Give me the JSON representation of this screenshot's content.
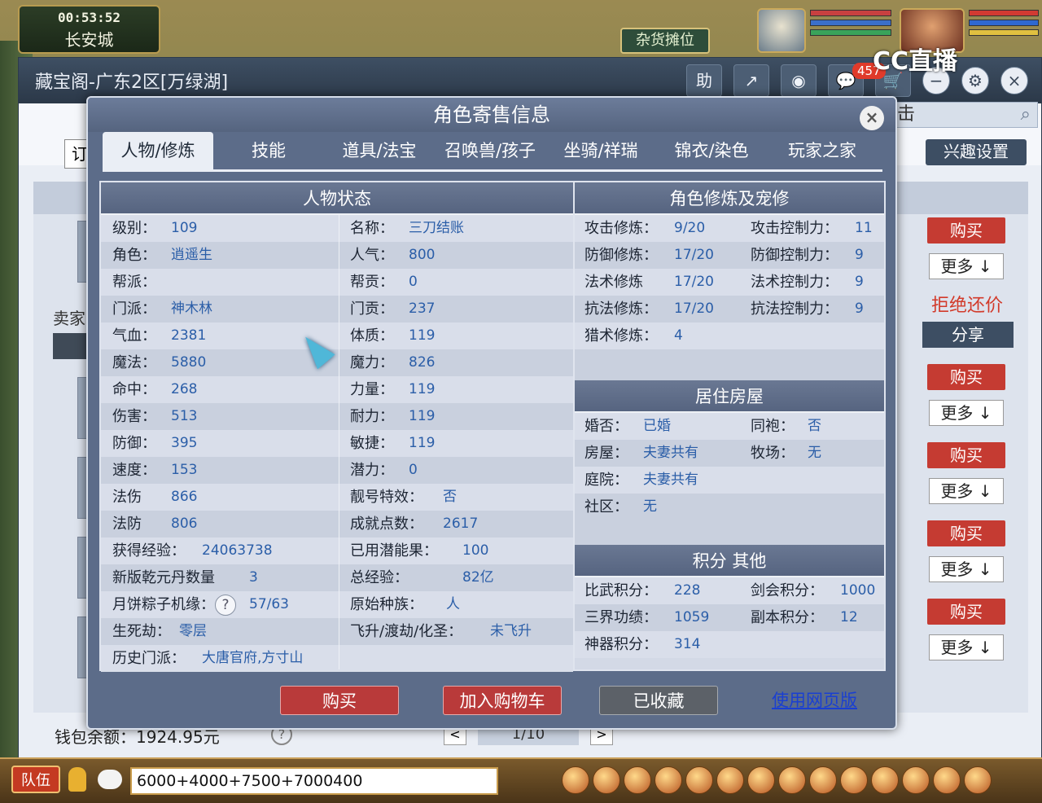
{
  "hud": {
    "time": "00:53:52",
    "city": "长安城",
    "vendor_button": "杂货摊位",
    "stream_logo": "CC直播",
    "message_badge": "457"
  },
  "cbg": {
    "window_title": "藏宝阁-广东2区[万绿湖]",
    "help_label": "助",
    "search_partial": "击",
    "interest_settings": "兴趣设置",
    "order_partial": "订",
    "seller_label": "卖家",
    "wallet": "钱包余额：1924.95元",
    "help_q": "?",
    "pager": {
      "prev": "<",
      "pages": "1/10",
      "next": ">"
    },
    "actions": {
      "buy": "购买",
      "more": "更多",
      "refuse": "拒绝还价",
      "share": "分享"
    }
  },
  "modal": {
    "title": "角色寄售信息",
    "close": "×",
    "tabs": [
      "人物/修炼",
      "技能",
      "道具/法宝",
      "召唤兽/孩子",
      "坐骑/祥瑞",
      "锦衣/染色",
      "玩家之家"
    ],
    "left_section": "人物状态",
    "left_rows": [
      {
        "l1": "级别：",
        "v1": "109",
        "l2": "名称：",
        "v2": "三刀结账"
      },
      {
        "l1": "角色：",
        "v1": "逍遥生",
        "l2": "人气：",
        "v2": "800"
      },
      {
        "l1": "帮派：",
        "v1": "",
        "l2": "帮贡：",
        "v2": "0"
      },
      {
        "l1": "门派：",
        "v1": "神木林",
        "l2": "门贡：",
        "v2": "237"
      },
      {
        "l1": "气血：",
        "v1": "2381",
        "l2": "体质：",
        "v2": "119"
      },
      {
        "l1": "魔法：",
        "v1": "5880",
        "l2": "魔力：",
        "v2": "826"
      },
      {
        "l1": "命中：",
        "v1": "268",
        "l2": "力量：",
        "v2": "119"
      },
      {
        "l1": "伤害：",
        "v1": "513",
        "l2": "耐力：",
        "v2": "119"
      },
      {
        "l1": "防御：",
        "v1": "395",
        "l2": "敏捷：",
        "v2": "119"
      },
      {
        "l1": "速度：",
        "v1": "153",
        "l2": "潜力：",
        "v2": "0"
      },
      {
        "l1": "法伤",
        "v1": "866",
        "l2": "靓号特效：",
        "v2": "否"
      },
      {
        "l1": "法防",
        "v1": "806",
        "l2": "成就点数：",
        "v2": "2617"
      },
      {
        "l1": "获得经验：",
        "v1": "24063738",
        "l2": "已用潜能果：",
        "v2": "100"
      },
      {
        "l1": "新版乾元丹数量",
        "v1": "3",
        "l2": "总经验：",
        "v2": "82亿"
      },
      {
        "l1": "月饼粽子机缘：",
        "v1": "57/63",
        "l2": "原始种族：",
        "v2": "人"
      },
      {
        "l1": "生死劫：",
        "v1": "零层",
        "l2": "飞升/渡劫/化圣：",
        "v2": "未飞升"
      },
      {
        "l1": "历史门派：",
        "v1": "大唐官府,方寸山",
        "l2": "",
        "v2": ""
      }
    ],
    "cultivation_section": "角色修炼及宠修",
    "cultivation_rows": [
      {
        "l1": "攻击修炼：",
        "v1": "9/20",
        "l2": "攻击控制力：",
        "v2": "11"
      },
      {
        "l1": "防御修炼：",
        "v1": "17/20",
        "l2": "防御控制力：",
        "v2": "9"
      },
      {
        "l1": "法术修炼",
        "v1": "17/20",
        "l2": "法术控制力：",
        "v2": "9"
      },
      {
        "l1": "抗法修炼：",
        "v1": "17/20",
        "l2": "抗法控制力：",
        "v2": "9"
      },
      {
        "l1": "猎术修炼：",
        "v1": "4",
        "l2": "",
        "v2": ""
      }
    ],
    "house_section": "居住房屋",
    "house_rows": [
      {
        "l1": "婚否：",
        "v1": "已婚",
        "l2": "同袍：",
        "v2": "否"
      },
      {
        "l1": "房屋：",
        "v1": "夫妻共有",
        "l2": "牧场：",
        "v2": "无"
      },
      {
        "l1": "庭院：",
        "v1": "夫妻共有",
        "l2": "",
        "v2": ""
      },
      {
        "l1": "社区：",
        "v1": "无",
        "l2": "",
        "v2": ""
      }
    ],
    "score_section": "积分 其他",
    "score_rows": [
      {
        "l1": "比武积分：",
        "v1": "228",
        "l2": "剑会积分：",
        "v2": "1000"
      },
      {
        "l1": "三界功绩：",
        "v1": "1059",
        "l2": "副本积分：",
        "v2": "12"
      },
      {
        "l1": "神器积分：",
        "v1": "314",
        "l2": "",
        "v2": ""
      }
    ],
    "buttons": {
      "buy": "购买",
      "cart": "加入购物车",
      "favorited": "已收藏",
      "web": "使用网页版"
    }
  },
  "chat": {
    "team_button": "队伍",
    "input_value": "6000+4000+7500+7000400"
  }
}
